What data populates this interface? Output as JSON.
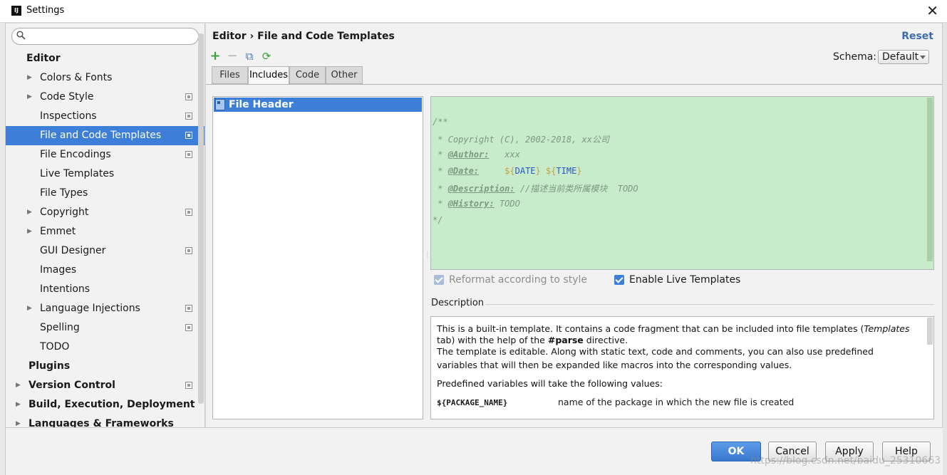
{
  "window": {
    "title": "Settings",
    "close_glyph": "✕",
    "app_icon_label": "IJ"
  },
  "search": {
    "value": "",
    "placeholder": ""
  },
  "sidebar": {
    "items": [
      {
        "label": "Editor",
        "group": true,
        "arrow": false,
        "scope": false
      },
      {
        "label": "Colors & Fonts",
        "arrow": true,
        "scope": false
      },
      {
        "label": "Code Style",
        "arrow": true,
        "scope": true
      },
      {
        "label": "Inspections",
        "arrow": false,
        "scope": true
      },
      {
        "label": "File and Code Templates",
        "arrow": false,
        "scope": true,
        "selected": true
      },
      {
        "label": "File Encodings",
        "arrow": false,
        "scope": true
      },
      {
        "label": "Live Templates",
        "arrow": false,
        "scope": false
      },
      {
        "label": "File Types",
        "arrow": false,
        "scope": false
      },
      {
        "label": "Copyright",
        "arrow": true,
        "scope": true
      },
      {
        "label": "Emmet",
        "arrow": true,
        "scope": false
      },
      {
        "label": "GUI Designer",
        "arrow": false,
        "scope": true
      },
      {
        "label": "Images",
        "arrow": false,
        "scope": false
      },
      {
        "label": "Intentions",
        "arrow": false,
        "scope": false
      },
      {
        "label": "Language Injections",
        "arrow": true,
        "scope": true
      },
      {
        "label": "Spelling",
        "arrow": false,
        "scope": true
      },
      {
        "label": "TODO",
        "arrow": false,
        "scope": false
      },
      {
        "label": "Plugins",
        "group": true,
        "arrow": false,
        "scope": false
      },
      {
        "label": "Version Control",
        "group": true,
        "arrow": true,
        "scope": true
      },
      {
        "label": "Build, Execution, Deployment",
        "group": true,
        "arrow": true,
        "scope": false
      },
      {
        "label": "Languages & Frameworks",
        "group": true,
        "arrow": true,
        "scope": false
      }
    ]
  },
  "main": {
    "breadcrumb": {
      "parent": "Editor",
      "separator": "›",
      "current": "File and Code Templates"
    },
    "reset_label": "Reset",
    "toolbar": {
      "add": "+",
      "remove": "−",
      "copy": "⧉",
      "reset": "⟳"
    },
    "schema": {
      "label": "Schema:",
      "value": "Default"
    },
    "tabs": [
      {
        "label": "Files",
        "active": false
      },
      {
        "label": "Includes",
        "active": true
      },
      {
        "label": "Code",
        "active": false
      },
      {
        "label": "Other",
        "active": false
      }
    ],
    "templates": [
      {
        "name": "File Header",
        "selected": true
      }
    ],
    "editor": {
      "open": "/**",
      "copyright": " * Copyright (C), 2002-2018, xx公司",
      "author_prefix": " * ",
      "author_tag": "@Author:",
      "author_value": "   xxx",
      "date_prefix": " * ",
      "date_tag": "@Date:",
      "date_gap": "     ",
      "date_var1_open": "${",
      "date_var1": "DATE",
      "date_var1_close": "}",
      "date_var2_open": " ${",
      "date_var2": "TIME",
      "date_var2_close": "}",
      "desc_prefix": " * ",
      "desc_tag": "@Description:",
      "desc_value": " //描述当前类所属模块  TODO",
      "history_prefix": " * ",
      "history_tag": "@History:",
      "history_value": " TODO",
      "close": "*/"
    },
    "options": {
      "reformat": {
        "label": "Reformat according to style",
        "checked": true,
        "disabled": true
      },
      "live_templates": {
        "label": "Enable Live Templates",
        "checked": true
      }
    },
    "description": {
      "title": "Description",
      "line1_a": "This is a built-in template. It contains a code fragment that can be included into file templates (",
      "line1_b": "Templates",
      "line2_a": "tab) with the help of the ",
      "line2_b": "#parse",
      "line2_c": " directive.",
      "line3": "The template is editable. Along with static text, code and comments, you can also use predefined",
      "line4": "variables that will then be expanded like macros into the corresponding values.",
      "line5": "Predefined variables will take the following values:",
      "var_name": "${PACKAGE_NAME}",
      "var_desc": "name of the package in which the new file is created"
    }
  },
  "footer": {
    "ok": "OK",
    "cancel": "Cancel",
    "apply": "Apply",
    "help": "Help",
    "watermark": "https://blog.csdn.net/baidu_25310663"
  },
  "colors": {
    "selection": "#3d7fd8",
    "editor_bg": "#c7ebcb",
    "link": "#3d6cae",
    "add_icon": "#3aa23a"
  }
}
